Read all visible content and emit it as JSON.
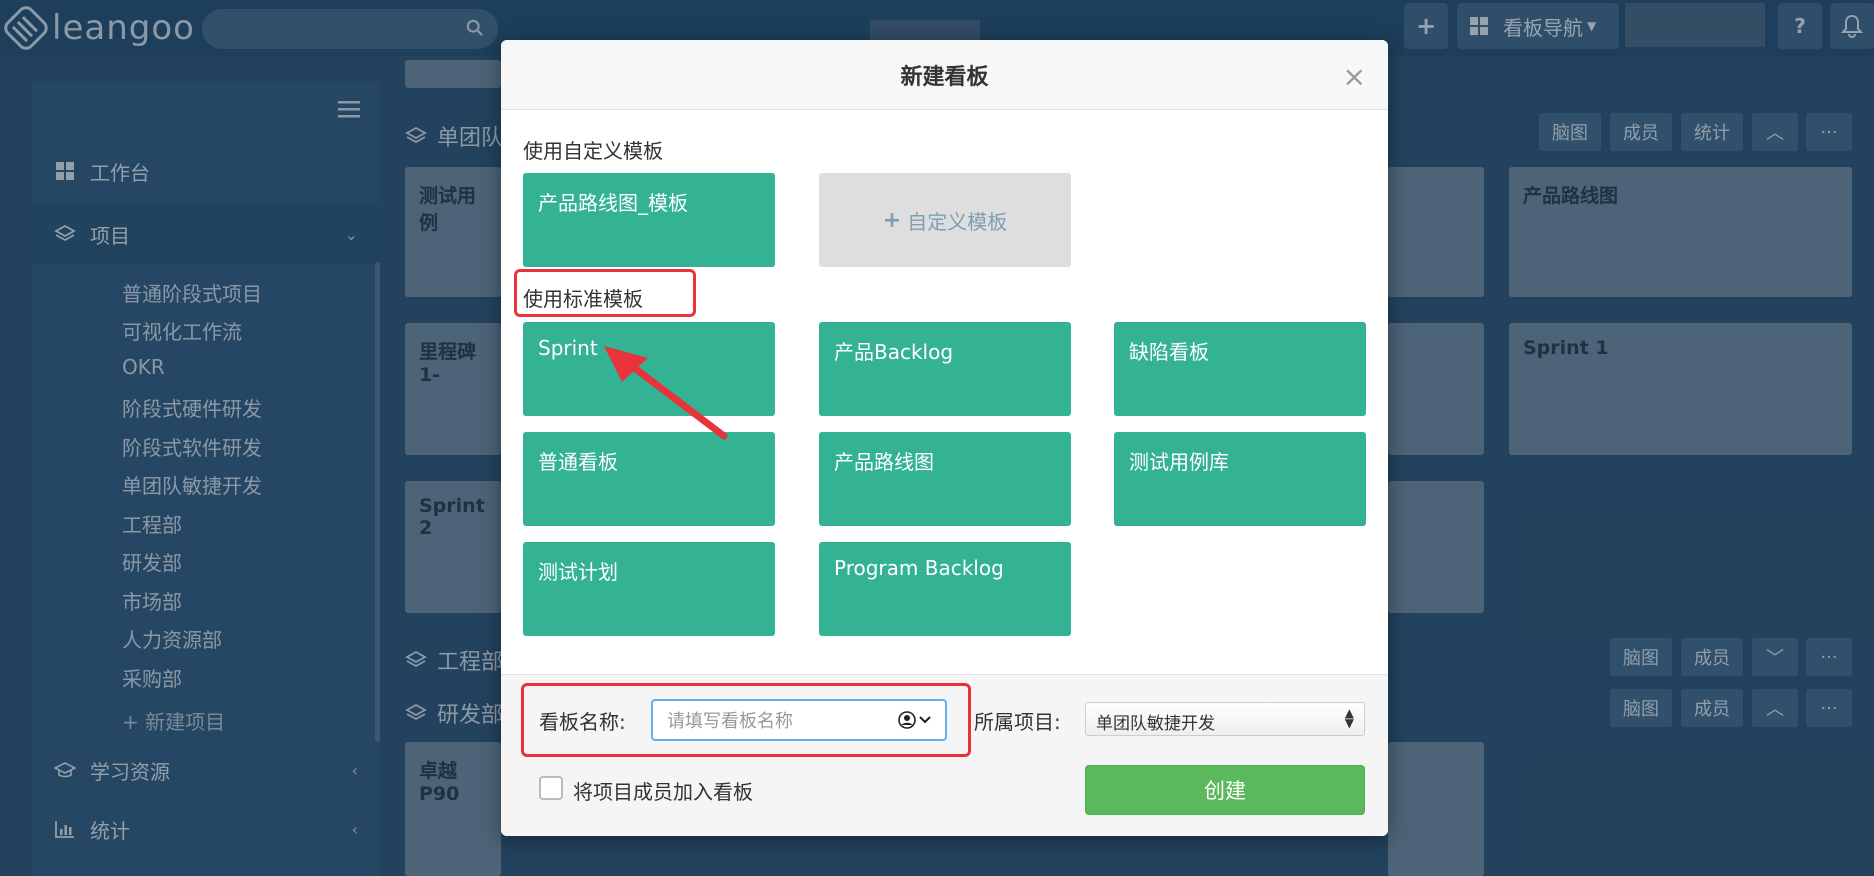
{
  "app": {
    "logo_text": "leangoo"
  },
  "topbar": {
    "add_label": "+",
    "board_nav_label": "看板导航",
    "help_label": "?"
  },
  "sidebar": {
    "items": [
      {
        "label": "工作台"
      },
      {
        "label": "项目"
      },
      {
        "label": "学习资源"
      },
      {
        "label": "统计"
      }
    ],
    "projects": [
      "普通阶段式项目",
      "可视化工作流",
      "OKR",
      "阶段式硬件研发",
      "阶段式软件研发",
      "单团队敏捷开发",
      "工程部",
      "研发部",
      "市场部",
      "人力资源部",
      "采购部"
    ],
    "new_project_label": "新建项目"
  },
  "background": {
    "sections": [
      "单团队",
      "工程部",
      "研发部"
    ],
    "cards": [
      "测试用例",
      "里程碑1-",
      "Sprint 2",
      "卓越P90",
      "产品路线图",
      "Sprint 1"
    ],
    "actions": {
      "mindmap": "脑图",
      "members": "成员",
      "stats": "统计",
      "more": "···"
    }
  },
  "modal": {
    "title": "新建看板",
    "close_label": "×",
    "custom_section_title": "使用自定义模板",
    "custom_templates": [
      "产品路线图_模板"
    ],
    "add_custom_label": "自定义模板",
    "standard_section_title": "使用标准模板",
    "standard_templates": [
      "Sprint",
      "产品Backlog",
      "缺陷看板",
      "普通看板",
      "产品路线图",
      "测试用例库",
      "测试计划",
      "Program Backlog"
    ],
    "board_name_label": "看板名称:",
    "board_name_placeholder": "请填写看板名称",
    "project_label": "所属项目:",
    "project_value": "单团队敏捷开发",
    "add_members_label": "将项目成员加入看板",
    "create_label": "创建"
  },
  "colors": {
    "template_green": "#33b294",
    "create_green": "#5cb85c",
    "highlight_red": "#e8333a"
  }
}
